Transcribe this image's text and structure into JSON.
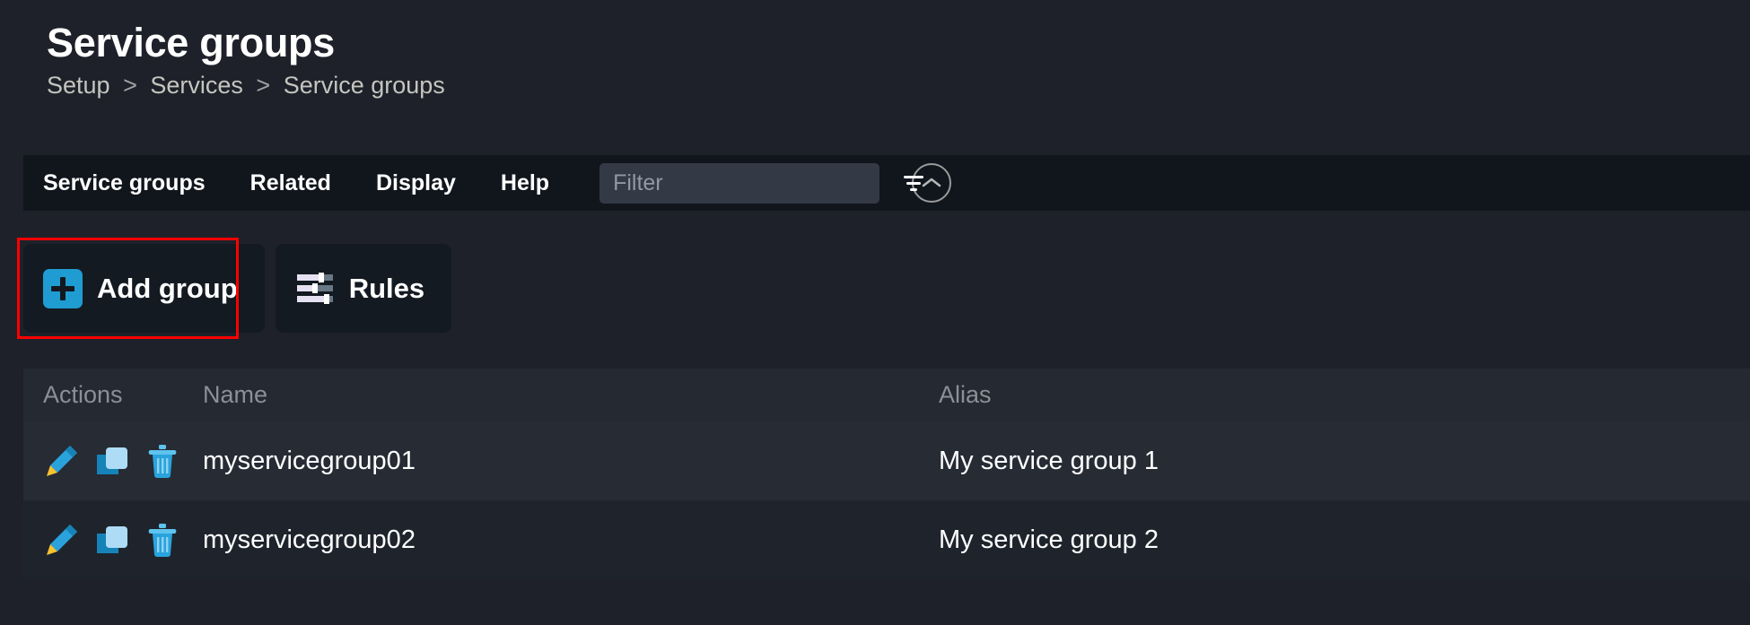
{
  "header": {
    "title": "Service groups",
    "breadcrumb": [
      "Setup",
      "Services",
      "Service groups"
    ],
    "separator": ">"
  },
  "menubar": {
    "items": [
      {
        "label": "Service groups",
        "name": "menu-service-groups"
      },
      {
        "label": "Related",
        "name": "menu-related"
      },
      {
        "label": "Display",
        "name": "menu-display"
      },
      {
        "label": "Help",
        "name": "menu-help"
      }
    ],
    "filter": {
      "value": "",
      "placeholder": "Filter",
      "icon": "filter-icon"
    },
    "collapse_button": {
      "icon": "chevron-up-icon"
    }
  },
  "actionbar": {
    "buttons": [
      {
        "label": "Add group",
        "icon": "plus-icon",
        "highlighted": true
      },
      {
        "label": "Rules",
        "icon": "sliders-icon",
        "highlighted": false
      }
    ],
    "highlight_color": "#ff0000"
  },
  "table": {
    "columns": [
      "Actions",
      "Name",
      "Alias"
    ],
    "row_action_icons": [
      "edit-pencil-icon",
      "clone-icon",
      "delete-trash-icon"
    ],
    "rows": [
      {
        "name": "myservicegroup01",
        "alias": "My service group 1"
      },
      {
        "name": "myservicegroup02",
        "alias": "My service group 2"
      }
    ]
  },
  "colors": {
    "page_background": "#1e2129",
    "menubar_background": "#11161d",
    "accent_blue": "#1f9cd2",
    "icon_light_blue": "#aedcf7",
    "icon_pencil_tip": "#f9c22e",
    "highlight_red": "#ff0000"
  }
}
